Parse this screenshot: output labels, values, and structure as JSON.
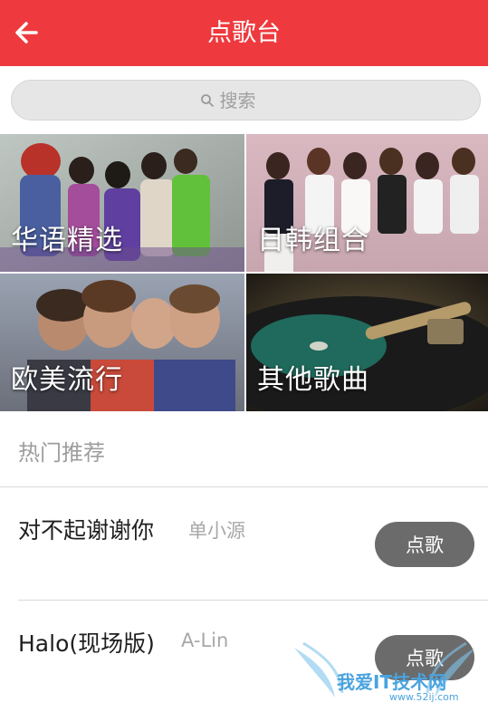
{
  "header": {
    "title": "点歌台",
    "back_icon": "arrow-left-icon",
    "color": "#ee3a3e"
  },
  "search": {
    "placeholder": "搜索",
    "icon": "search-icon"
  },
  "categories": [
    {
      "label": "华语精选"
    },
    {
      "label": "日韩组合"
    },
    {
      "label": "欧美流行"
    },
    {
      "label": "其他歌曲"
    }
  ],
  "hot": {
    "title": "热门推荐",
    "songs": [
      {
        "title": "对不起谢谢你",
        "artist": "单小源",
        "button": "点歌"
      },
      {
        "title": "Halo(现场版)",
        "artist": "A-Lin",
        "button": "点歌"
      }
    ]
  },
  "watermark": {
    "text": "我爱IT技术网",
    "url": "www.52ij.com"
  }
}
